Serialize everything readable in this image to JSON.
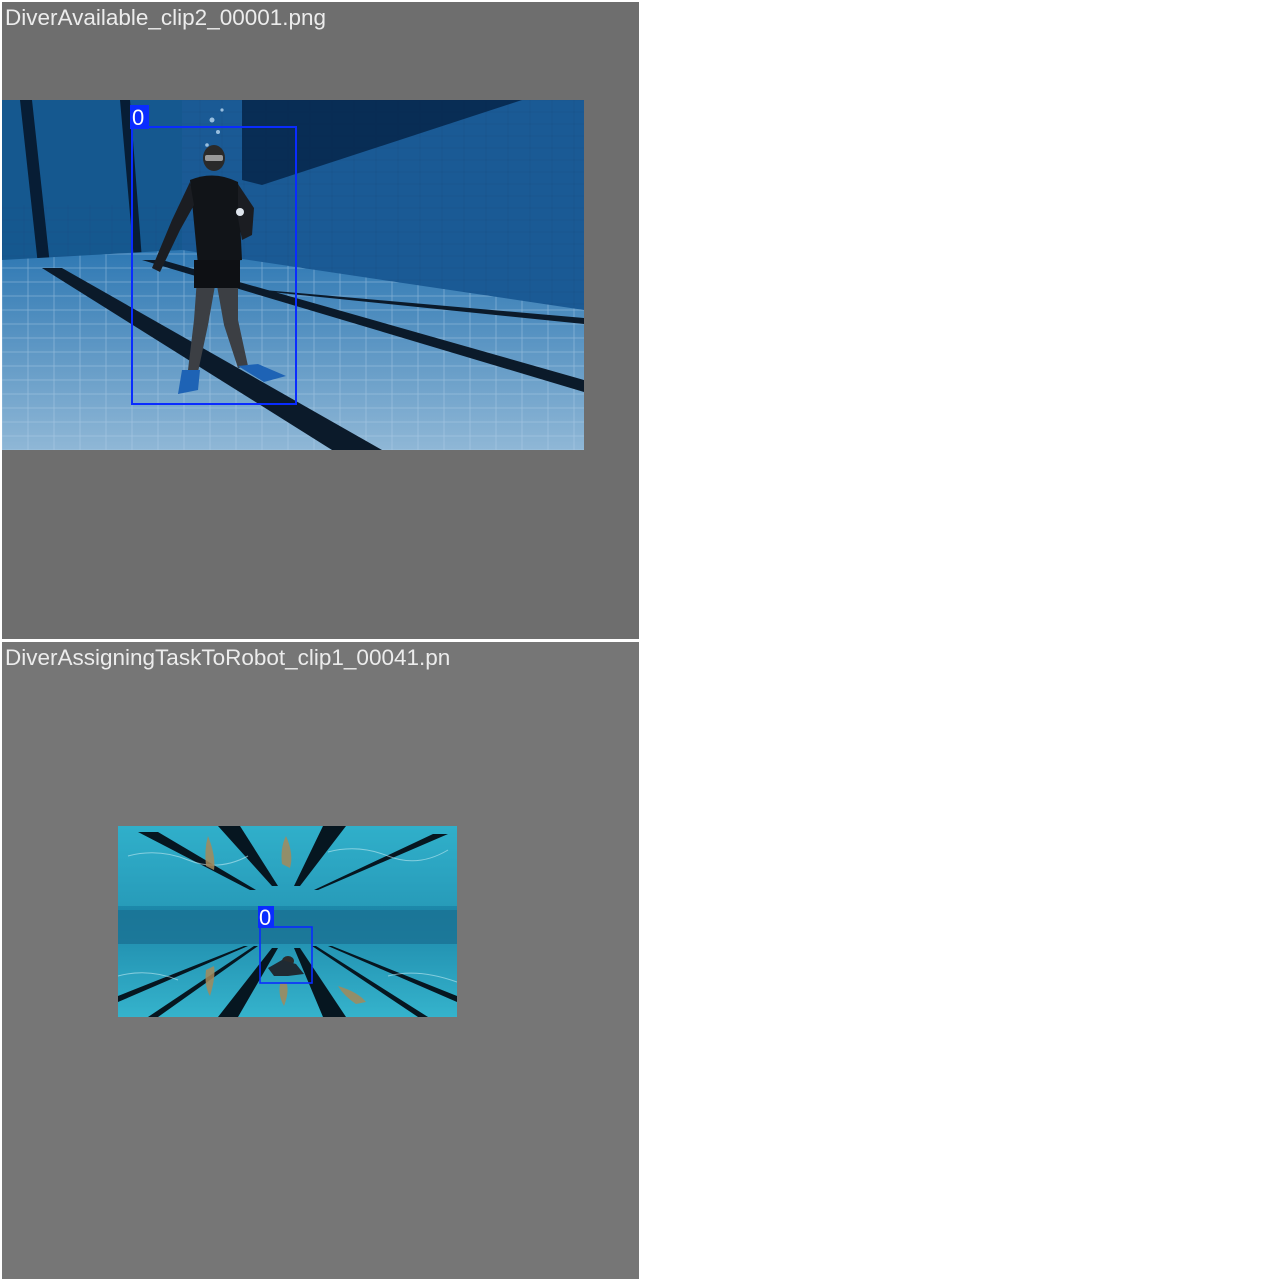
{
  "tiles": [
    {
      "filename": "DiverAvailable_clip2_00001.png",
      "detections": [
        {
          "class_label": "0"
        }
      ]
    },
    {
      "filename": "DiverAssigningTaskToRobot_clip1_00041.pn",
      "detections": [
        {
          "class_label": "0"
        }
      ]
    }
  ],
  "colors": {
    "tile_background": "#6e6e6e",
    "title_text": "#ececec",
    "bbox": "#0a2cff",
    "page_background": "#ffffff"
  }
}
